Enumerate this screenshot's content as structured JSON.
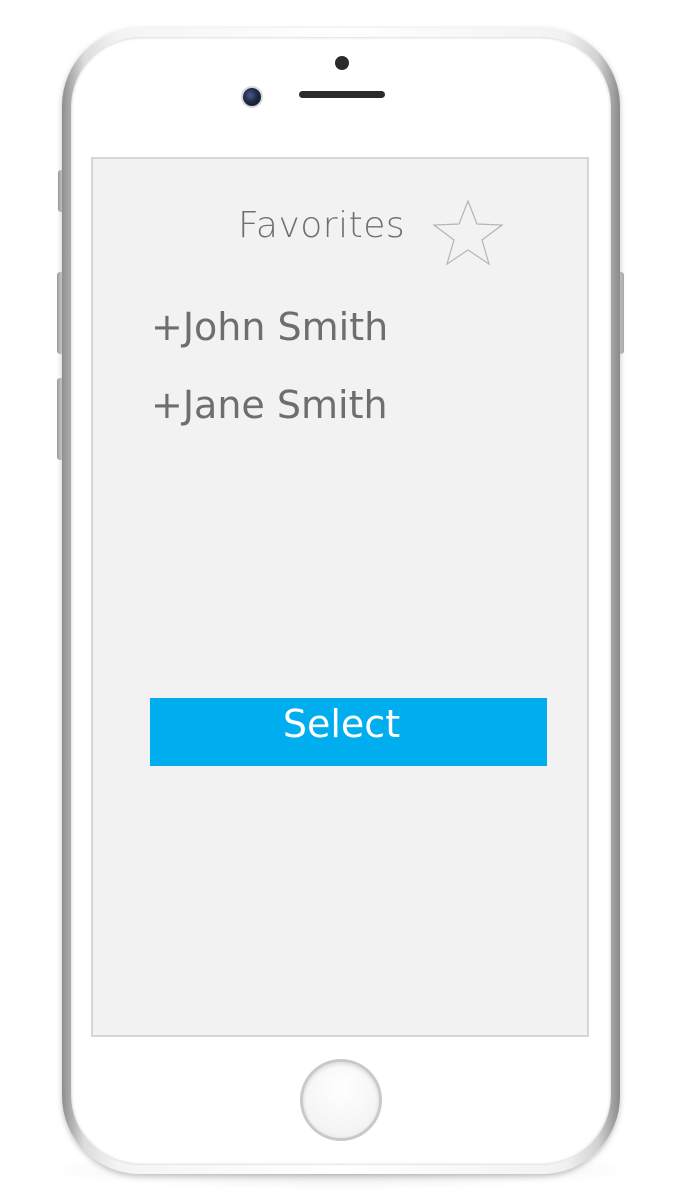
{
  "header": {
    "title": "Favorites",
    "icon": "star-icon"
  },
  "contacts": [
    {
      "label": "+John Smith"
    },
    {
      "label": "+Jane Smith"
    }
  ],
  "actions": {
    "select_label": "Select"
  },
  "colors": {
    "accent": "#00aeef",
    "screen_background": "#f2f2f2",
    "text": "#6e6e6e"
  },
  "device": {
    "home_button_icon": "home-button-circle"
  }
}
